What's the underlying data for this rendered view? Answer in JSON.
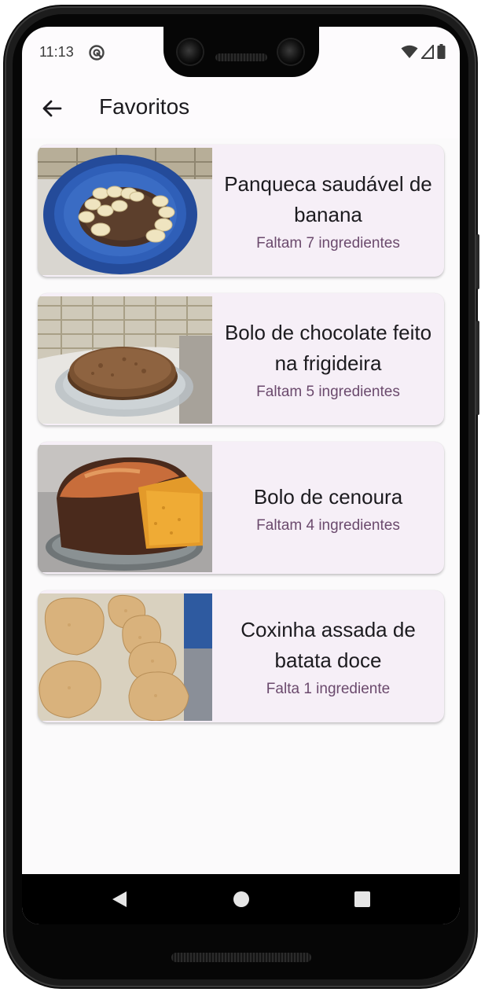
{
  "status_bar": {
    "time": "11:13"
  },
  "app_bar": {
    "title": "Favoritos"
  },
  "recipes": [
    {
      "name": "Panqueca saudável de banana",
      "missing": "Faltam 7 ingredientes"
    },
    {
      "name": "Bolo de chocolate feito na frigideira",
      "missing": "Faltam 5 ingredientes"
    },
    {
      "name": "Bolo de cenoura",
      "missing": "Faltam 4 ingredientes"
    },
    {
      "name": "Coxinha assada de batata doce",
      "missing": "Falta 1 ingrediente"
    }
  ],
  "icons": {
    "back": "arrow-left-icon",
    "status_app": "app-notification-icon",
    "wifi": "wifi-icon",
    "signal": "cell-signal-icon",
    "battery": "battery-icon",
    "nav_back": "triangle-back-icon",
    "nav_home": "circle-home-icon",
    "nav_recents": "square-recents-icon"
  },
  "colors": {
    "card_background": "#f6eff7",
    "subtitle": "#6b4a6d",
    "screen_background": "#fdfbfd"
  }
}
